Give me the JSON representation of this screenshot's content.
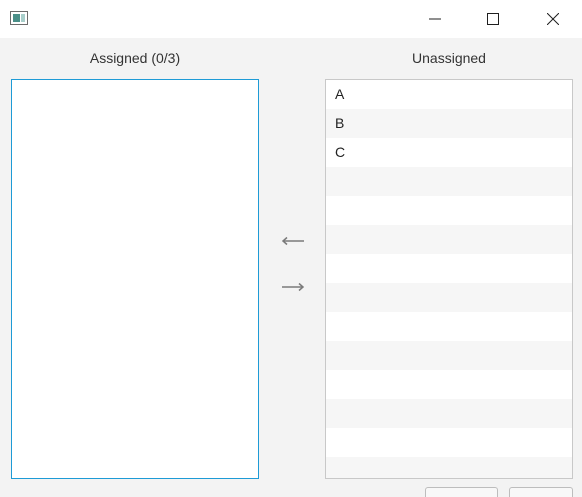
{
  "window": {
    "minimize_icon": "minimize-icon",
    "maximize_icon": "maximize-icon",
    "close_icon": "close-icon"
  },
  "assigned": {
    "label": "Assigned (0/3)",
    "items": []
  },
  "unassigned": {
    "label": "Unassigned",
    "items": [
      "A",
      "B",
      "C",
      "",
      "",
      "",
      "",
      "",
      "",
      "",
      "",
      "",
      "",
      ""
    ]
  },
  "controls": {
    "move_left_icon": "arrow-left-icon",
    "move_right_icon": "arrow-right-icon"
  },
  "colors": {
    "focus_border": "#1e9bd6",
    "background": "#f3f3f3",
    "alt_row": "#f6f6f6"
  }
}
